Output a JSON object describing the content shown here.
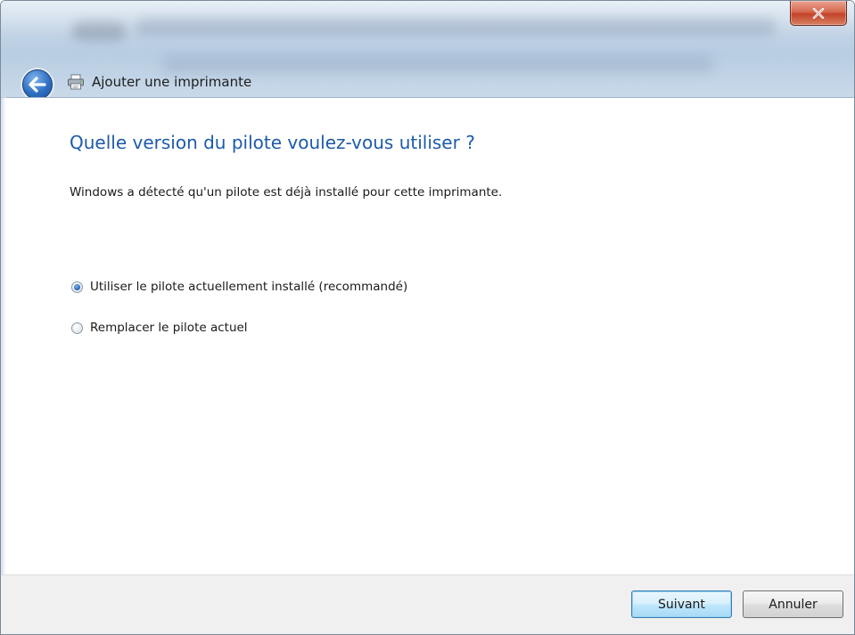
{
  "window": {
    "title": "Ajouter une imprimante"
  },
  "titlebar": {
    "close_label": "x"
  },
  "main": {
    "heading": "Quelle version du pilote voulez-vous utiliser ?",
    "description": "Windows a détecté qu'un pilote est déjà installé pour cette imprimante.",
    "options": [
      {
        "label": "Utiliser le pilote actuellement installé (recommandé)",
        "selected": true
      },
      {
        "label": "Remplacer le pilote actuel",
        "selected": false
      }
    ]
  },
  "footer": {
    "next_label": "Suivant",
    "cancel_label": "Annuler"
  },
  "colors": {
    "heading": "#1d5aa9",
    "close_button": "#c2432a",
    "back_button": "#2e6fc2"
  }
}
